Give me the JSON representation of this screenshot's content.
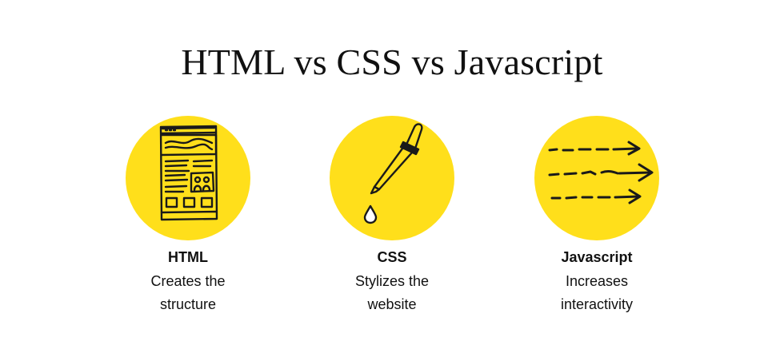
{
  "title": "HTML vs CSS vs Javascript",
  "accent_color": "#FFDF1B",
  "items": [
    {
      "icon": "webpage-wireframe-icon",
      "label": "HTML",
      "line1": "Creates the",
      "line2": "structure"
    },
    {
      "icon": "eyedropper-icon",
      "label": "CSS",
      "line1": "Stylizes the",
      "line2": "website"
    },
    {
      "icon": "motion-arrows-icon",
      "label": "Javascript",
      "line1": "Increases",
      "line2": "interactivity"
    }
  ]
}
